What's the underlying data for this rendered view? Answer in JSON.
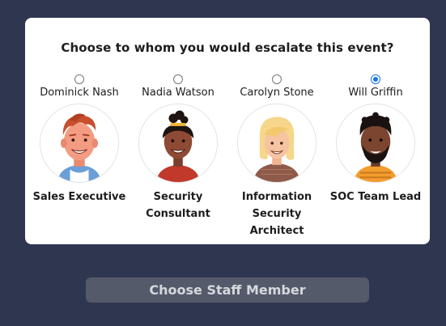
{
  "dialog": {
    "question": "Choose to whom you would escalate this event?"
  },
  "staff": [
    {
      "name": "Dominick Nash",
      "role": "Sales Executive",
      "selected": false,
      "avatar": "man-avatar-icon"
    },
    {
      "name": "Nadia Watson",
      "role": "Security\nConsultant",
      "selected": false,
      "avatar": "woman-avatar-icon"
    },
    {
      "name": "Carolyn Stone",
      "role": "Information\nSecurity\nArchitect",
      "selected": false,
      "avatar": "woman-avatar-icon"
    },
    {
      "name": "Will Griffin",
      "role": "SOC Team Lead",
      "selected": true,
      "avatar": "man-avatar-icon"
    }
  ],
  "action": {
    "button_label": "Choose Staff Member"
  },
  "colors": {
    "background": "#2f3650",
    "card": "#ffffff",
    "button": "#545a6a",
    "radio_selected": "#1a73e8"
  }
}
